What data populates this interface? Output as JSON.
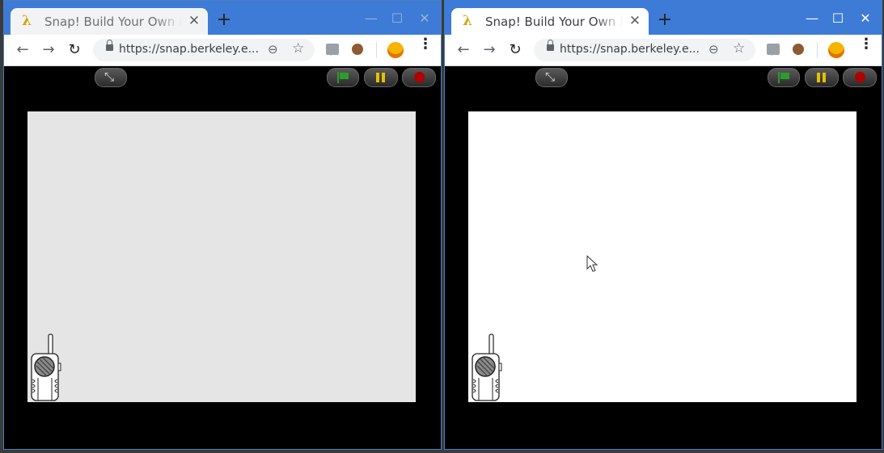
{
  "windows": [
    {
      "id": "left",
      "tab": {
        "title": "Snap! Build Your Own Blocks",
        "favicon": "λ"
      },
      "address": "https://snap.berkeley.edu/snap/snap.html",
      "address_display": "https://snap.berkeley.e...",
      "stage_background": "#e5e5e5"
    },
    {
      "id": "right",
      "tab": {
        "title": "Snap! Build Your Own Blocks",
        "favicon": "λ"
      },
      "address": "https://snap.berkeley.edu/snap/snap.html",
      "address_display": "https://snap.berkeley.e...",
      "stage_background": "#ffffff"
    }
  ],
  "icons": {
    "favicon": "lambda-icon",
    "tab_close": "close-icon",
    "new_tab": "plus-icon",
    "back": "arrow-left-icon",
    "forward": "arrow-right-icon",
    "reload": "reload-icon",
    "zoom": "zoom-out-icon",
    "bookmark": "star-icon",
    "extensions": [
      "chat-extension-icon",
      "cookie-extension-icon"
    ],
    "profile": "avatar-icon",
    "menu": "kebab-menu-icon",
    "stage_controls": [
      "unzoom-icon",
      "green-flag-icon",
      "pause-icon",
      "stop-icon"
    ]
  },
  "symbols": {
    "favicon": "λ",
    "close": "✕",
    "new_tab": "+",
    "back": "←",
    "forward": "→",
    "reload": "↻",
    "zoom": "⊖",
    "star": "☆",
    "minimize": "—",
    "maximize": "☐",
    "window_close": "✕",
    "kebab": "⋮",
    "unzoom": "⤡"
  },
  "colors": {
    "tabstrip": "#3d7bd6",
    "flag_green": "#2c9d2c",
    "pause_yellow": "#e5c000",
    "stop_red": "#b00000"
  }
}
